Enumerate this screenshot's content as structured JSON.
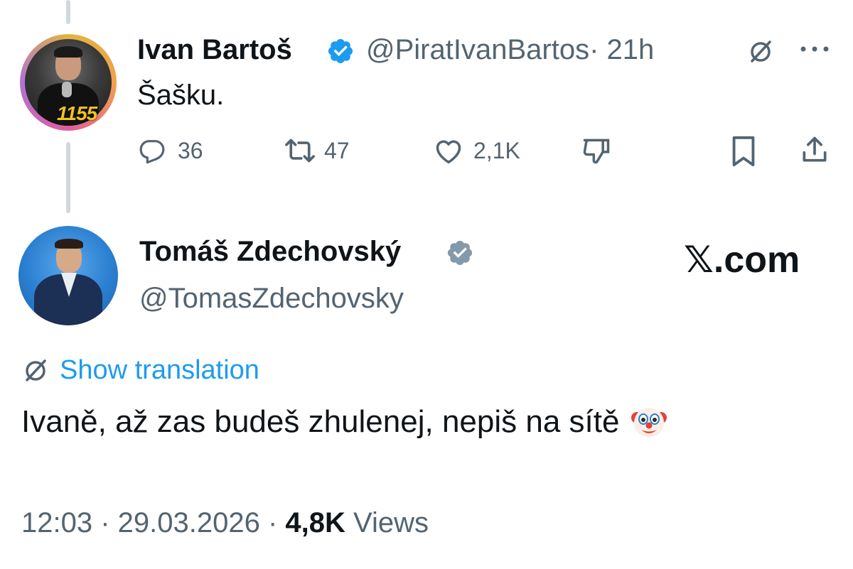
{
  "parent_tweet": {
    "display_name": "Ivan Bartoš",
    "handle": "@PiratIvanBartos",
    "time": "· 21h",
    "text": "Šašku.",
    "avatar_badge": "1155",
    "actions": {
      "replies": "36",
      "reposts": "47",
      "likes": "2,1K"
    }
  },
  "main_tweet": {
    "display_name": "Tomáš Zdechovský",
    "handle": "@TomasZdechovsky",
    "watermark": "𝕏.com",
    "show_translation": "Show translation",
    "text": "Ivaně, až zas budeš zhulenej, nepiš na sítě",
    "timestamp": "12:03 · 29.03.2026 ·",
    "views_count": "4,8K",
    "views_label": "Views"
  },
  "colors": {
    "accent": "#1d9bf0",
    "verified_blue": "#1d9bf0",
    "verified_gray": "#829aab",
    "secondary_text": "#536471",
    "primary_text": "#0f1419",
    "thread_line": "#cfd9de"
  }
}
